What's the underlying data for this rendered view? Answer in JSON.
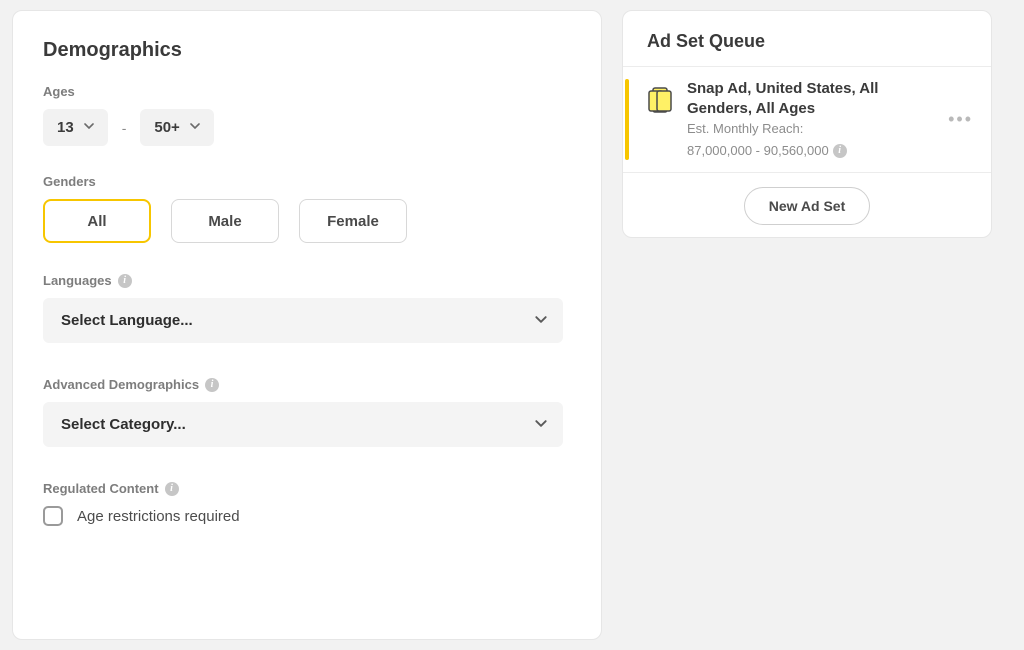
{
  "demographics": {
    "title": "Demographics",
    "ages_label": "Ages",
    "age_min": "13",
    "age_max": "50+",
    "age_separator": "-",
    "genders_label": "Genders",
    "genders": [
      "All",
      "Male",
      "Female"
    ],
    "gender_selected": "All",
    "languages_label": "Languages",
    "languages_placeholder": "Select Language...",
    "advanced_label": "Advanced Demographics",
    "advanced_placeholder": "Select Category...",
    "regulated_label": "Regulated Content",
    "age_restrict_label": "Age restrictions required"
  },
  "queue": {
    "title": "Ad Set Queue",
    "item": {
      "title": "Snap Ad, United States, All Genders, All Ages",
      "reach_label": "Est. Monthly Reach:",
      "reach_value": "87,000,000 - 90,560,000"
    },
    "new_button": "New Ad Set"
  },
  "icons": {
    "more": "•••"
  }
}
